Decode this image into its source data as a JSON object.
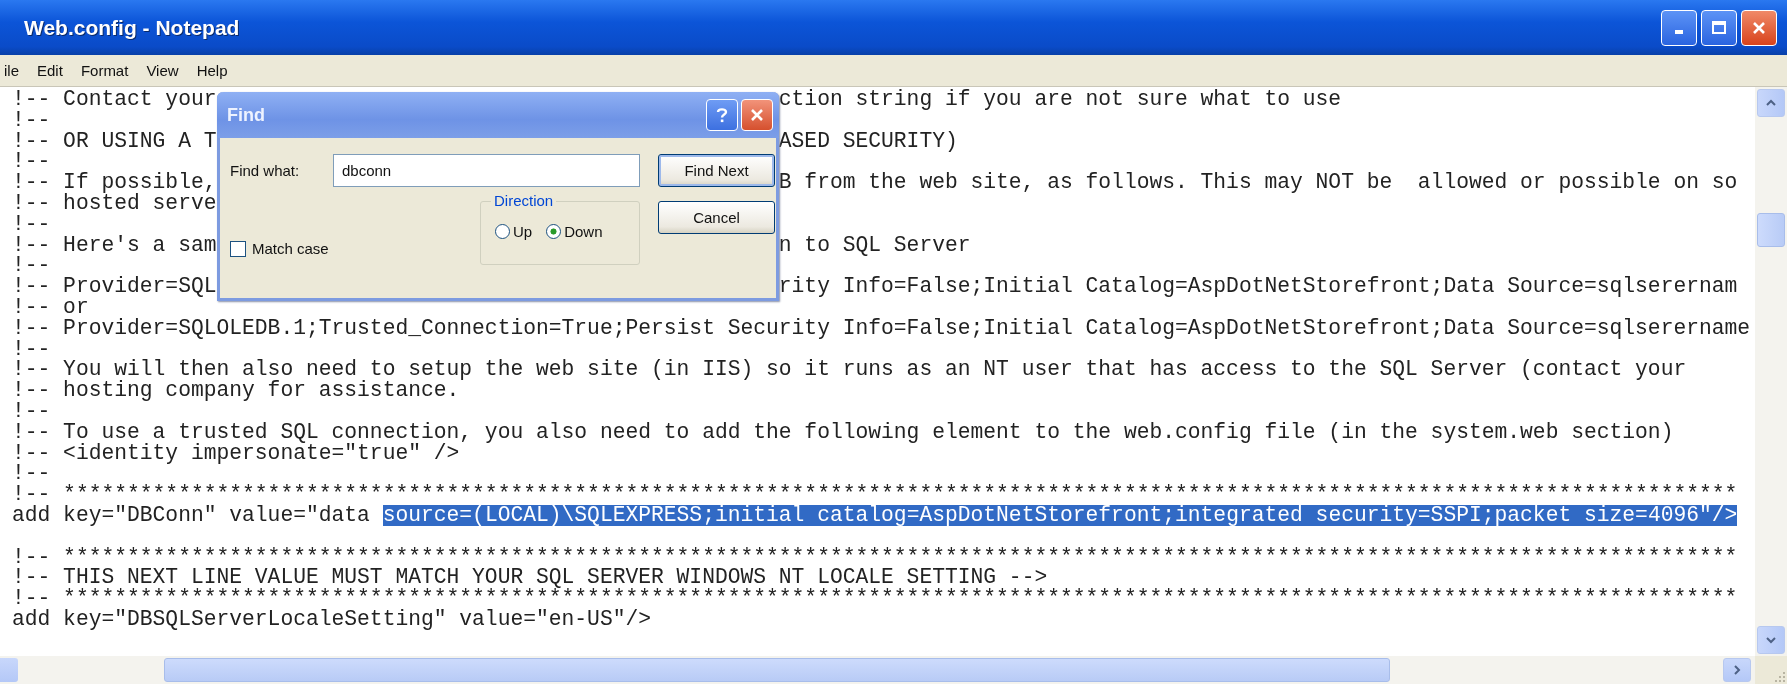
{
  "window": {
    "title": "Web.config - Notepad"
  },
  "menu": [
    {
      "label": "ile"
    },
    {
      "label": "Edit"
    },
    {
      "label": "Format"
    },
    {
      "label": "View"
    },
    {
      "label": "Help"
    }
  ],
  "editor": {
    "lines": [
      {
        "text": "!-- Contact your",
        "right": "ction string if you are not sure what to use"
      },
      {
        "text": "!--"
      },
      {
        "text": "!-- OR USING A T",
        "right": "ASED SECURITY)"
      },
      {
        "text": "!--"
      },
      {
        "text": "!-- If possible,",
        "right": "B from the web site, as follows. This may NOT be  allowed or possible on so"
      },
      {
        "text": "!-- hosted serve"
      },
      {
        "text": "!--"
      },
      {
        "text": "!-- Here's a sam",
        "right": "n to SQL Server"
      },
      {
        "text": "!--"
      },
      {
        "text": "!-- Provider=SQL",
        "right": "rity Info=False;Initial Catalog=AspDotNetStorefront;Data Source=sqlserernam"
      },
      {
        "text": "!-- or"
      },
      {
        "text": "!-- Provider=SQLOLEDB.1;Trusted_Connection=True;Persist Security Info=False;Initial Catalog=AspDotNetStorefront;Data Source=sqlserername"
      },
      {
        "text": "!--"
      },
      {
        "text": "!-- You will then also need to setup the web site (in IIS) so it runs as an NT user that has access to the SQL Server (contact your"
      },
      {
        "text": "!-- hosting company for assistance."
      },
      {
        "text": "!--"
      },
      {
        "text": "!-- To use a trusted SQL connection, you also need to add the following element to the web.config file (in the system.web section)"
      },
      {
        "text": "!-- <identity impersonate=\"true\" />"
      },
      {
        "text": "!--"
      },
      {
        "text": "!-- ***********************************************************************************************************************************"
      },
      {
        "text": "add key=\"DBConn\" value=\"data ",
        "selection": "source=(LOCAL)\\SQLEXPRESS;initial catalog=AspDotNetStorefront;integrated security=SSPI;packet size=4096\"/>"
      },
      {
        "text": "!-- ***********************************************************************************************************************************"
      },
      {
        "text": "!-- THIS NEXT LINE VALUE MUST MATCH YOUR SQL SERVER WINDOWS NT LOCALE SETTING -->"
      },
      {
        "text": "!-- ***********************************************************************************************************************************"
      },
      {
        "text": "add key=\"DBSQLServerLocaleSetting\" value=\"en-US\"/>"
      }
    ]
  },
  "dialog": {
    "title": "Find",
    "find_what": {
      "label": "Find what:",
      "value": "dbconn"
    },
    "match_case": {
      "label": "Match case",
      "checked": false
    },
    "direction": {
      "label": "Direction",
      "options": [
        {
          "label": "Up",
          "selected": false
        },
        {
          "label": "Down",
          "selected": true
        }
      ]
    },
    "buttons": [
      {
        "label": "Find Next",
        "default": true
      },
      {
        "label": "Cancel",
        "default": false
      }
    ]
  }
}
